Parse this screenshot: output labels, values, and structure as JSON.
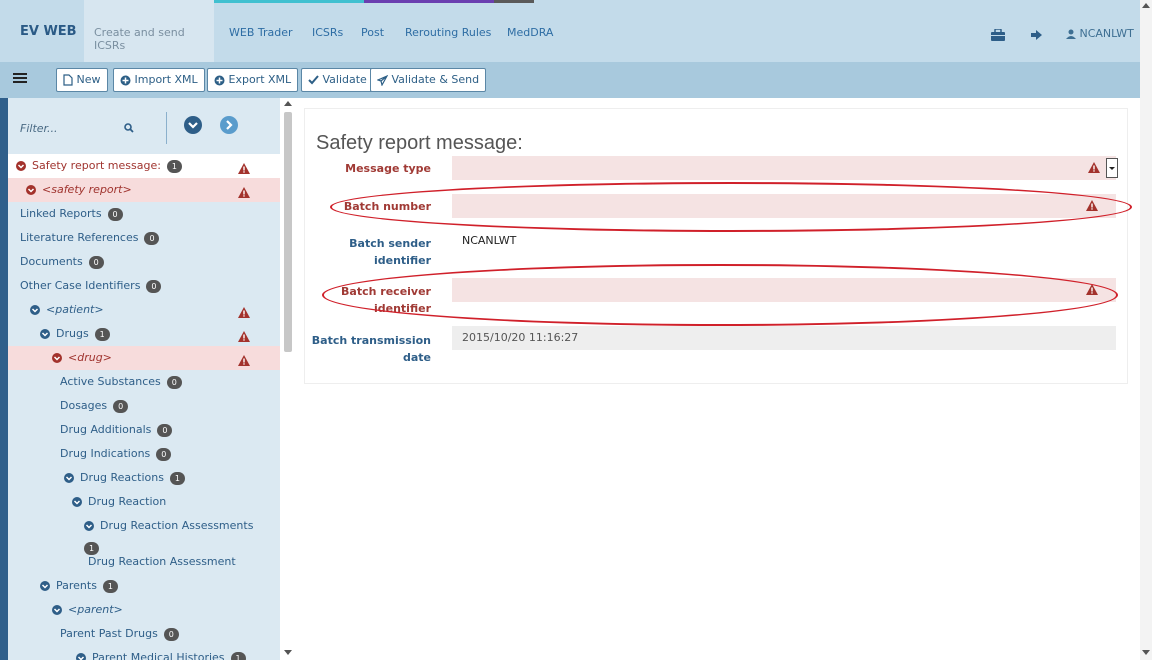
{
  "topnav": {
    "brand": "EV WEB",
    "items": [
      "Create and send ICSRs",
      "WEB Trader",
      "ICSRs",
      "Post",
      "Rerouting Rules",
      "MedDRA"
    ],
    "user": "NCANLWT",
    "colors": {
      "bar": "#c3dbea",
      "link": "#2e6da4"
    }
  },
  "toolbar": {
    "buttons": [
      {
        "label": "New",
        "icon": "file-icon"
      },
      {
        "label": "Import XML",
        "icon": "plus-circle-icon"
      },
      {
        "label": "Export XML",
        "icon": "plus-circle-icon"
      },
      {
        "label": "Validate",
        "icon": "check-icon"
      },
      {
        "label": "Validate & Send",
        "icon": "send-icon"
      }
    ]
  },
  "sidebar": {
    "filter_placeholder": "Filter...",
    "tree": [
      {
        "label": "Safety report message:",
        "badge": "1",
        "warn": true,
        "state": "selected",
        "chevron": true
      },
      {
        "label": "<safety report>",
        "warn": true,
        "state": "error",
        "chevron": true,
        "italic": true
      },
      {
        "label": "Linked Reports",
        "badge": "0"
      },
      {
        "label": "Literature References",
        "badge": "0"
      },
      {
        "label": "Documents",
        "badge": "0"
      },
      {
        "label": "Other Case Identifiers",
        "badge": "0"
      },
      {
        "label": "<patient>",
        "warn": true,
        "chevron": true,
        "italic": true
      },
      {
        "label": "Drugs",
        "badge": "1",
        "warn": true,
        "chevron": true
      },
      {
        "label": "<drug>",
        "warn": true,
        "state": "error",
        "chevron": true,
        "italic": true
      },
      {
        "label": "Active Substances",
        "badge": "0"
      },
      {
        "label": "Dosages",
        "badge": "0"
      },
      {
        "label": "Drug Additionals",
        "badge": "0"
      },
      {
        "label": "Drug Indications",
        "badge": "0"
      },
      {
        "label": "Drug Reactions",
        "badge": "1",
        "chevron": true
      },
      {
        "label": "Drug Reaction",
        "chevron": true
      },
      {
        "label": "Drug Reaction Assessments",
        "badge": "1",
        "chevron": true
      },
      {
        "label": "Drug Reaction Assessment"
      },
      {
        "label": "Parents",
        "badge": "1",
        "chevron": true
      },
      {
        "label": "<parent>",
        "chevron": true,
        "italic": true
      },
      {
        "label": "Parent Past Drugs",
        "badge": "0"
      },
      {
        "label": "Parent Medical Histories",
        "badge": "1",
        "chevron": true
      }
    ]
  },
  "main": {
    "title": "Safety report message:",
    "fields": [
      {
        "label": "Message type",
        "value": "",
        "state": "error"
      },
      {
        "label": "Batch number",
        "value": "",
        "state": "error"
      },
      {
        "label": "Batch sender identifier",
        "value": "NCANLWT",
        "state": "plain"
      },
      {
        "label": "Batch receiver identifier",
        "value": "",
        "state": "error"
      },
      {
        "label": "Batch transmission date",
        "value": "2015/10/20 11:16:27",
        "state": "readonly"
      }
    ]
  }
}
